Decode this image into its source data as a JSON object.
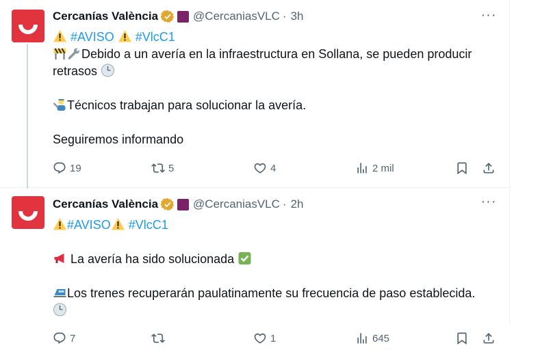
{
  "tweets": [
    {
      "account_name": "Cercanías València",
      "handle": "@CercaniasVLC",
      "separator": "·",
      "time": "3h",
      "hashtag_aviso": "#AVISO",
      "hashtag_line": "#VlcC1",
      "line1": "Debido a un avería en la infraestructura en Sollana, se pueden producir retrasos",
      "line2": "Técnicos trabajan para solucionar la avería.",
      "line3": "Seguiremos informando",
      "replies": "19",
      "reposts": "5",
      "likes": "4",
      "views": "2 mil"
    },
    {
      "account_name": "Cercanías València",
      "handle": "@CercaniasVLC",
      "separator": "·",
      "time": "2h",
      "hashtag_aviso": "#AVISO",
      "hashtag_line": "#VlcC1",
      "line1": "La avería ha sido solucionada",
      "line2": "Los trenes recuperarán paulatinamente su frecuencia de paso establecida.",
      "replies": "7",
      "reposts": "",
      "likes": "1",
      "views": "645"
    }
  ],
  "colors": {
    "brand": "#e2343e",
    "link": "#1d9bf0",
    "muted": "#536471",
    "affiliate": "#7b2368"
  },
  "icons": [
    "verified-badge-icon",
    "affiliate-badge-icon",
    "more-icon",
    "reply-icon",
    "repost-icon",
    "like-icon",
    "views-icon",
    "bookmark-icon",
    "share-icon",
    "warning-emoji",
    "construction-emoji",
    "wrench-emoji",
    "clock-emoji",
    "mechanic-emoji",
    "megaphone-emoji",
    "check-emoji",
    "train-emoji"
  ]
}
